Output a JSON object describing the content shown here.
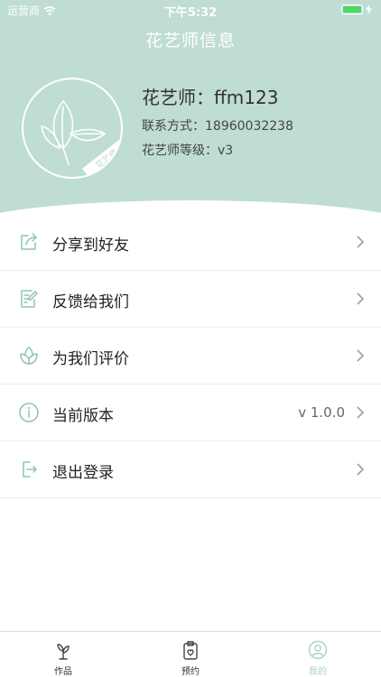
{
  "status_bar": {
    "carrier": "运营商",
    "time": "下午5:32"
  },
  "nav": {
    "title": "花艺师信息"
  },
  "profile": {
    "name": "花艺师：ffm123",
    "contact": "联系方式：18960032238",
    "level": "花艺师等级：v3",
    "avatar_stamp": "花艺师"
  },
  "menu": [
    {
      "label": "分享到好友",
      "icon": "share-icon",
      "value": ""
    },
    {
      "label": "反馈给我们",
      "icon": "feedback-icon",
      "value": ""
    },
    {
      "label": "为我们评价",
      "icon": "flower-rating-icon",
      "value": ""
    },
    {
      "label": "当前版本",
      "icon": "info-icon",
      "value": "v 1.0.0"
    },
    {
      "label": "退出登录",
      "icon": "logout-icon",
      "value": ""
    }
  ],
  "tabbar": [
    {
      "label": "作品",
      "icon": "works-icon",
      "active": false
    },
    {
      "label": "预约",
      "icon": "appointment-icon",
      "active": false
    },
    {
      "label": "我的",
      "icon": "profile-icon",
      "active": true
    }
  ],
  "colors": {
    "header_bg": "#bfddd3",
    "accent": "#a9d3c5",
    "icon_line": "#8fc4b3",
    "battery": "#4cd964"
  }
}
